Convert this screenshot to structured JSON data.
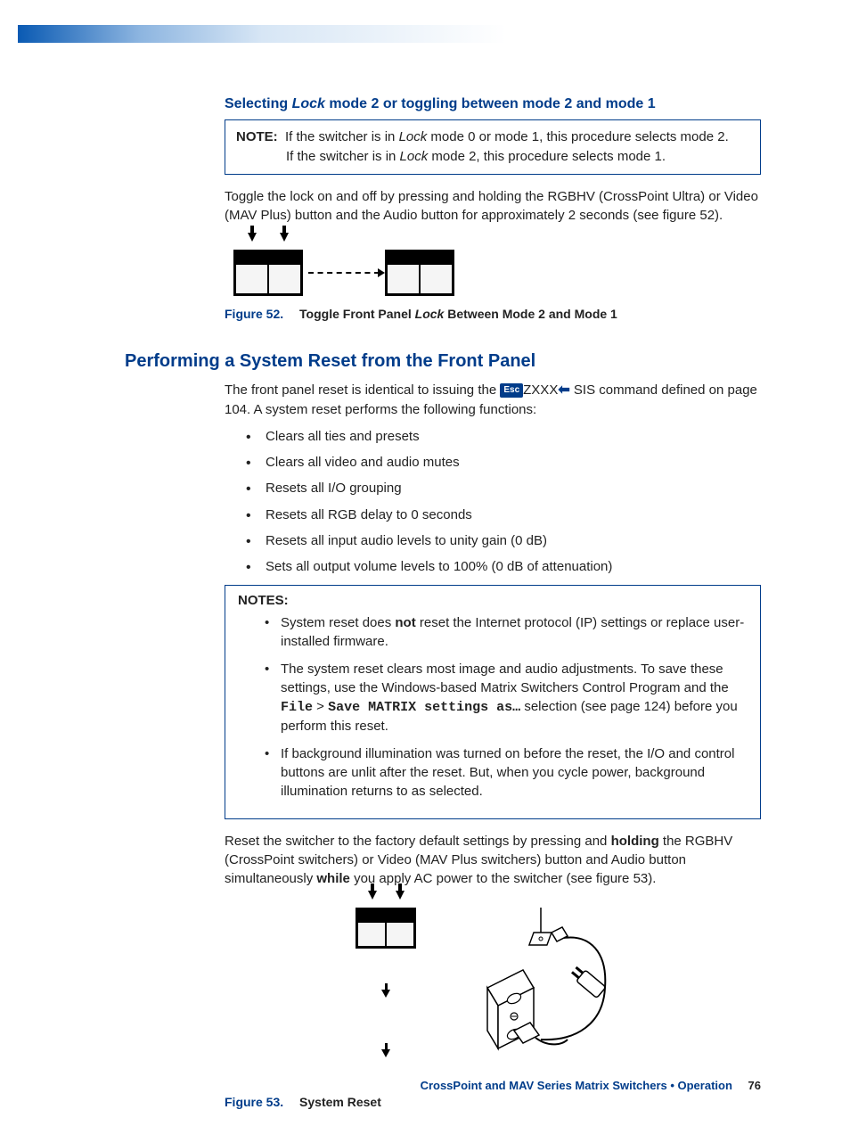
{
  "section1": {
    "heading_pre": "Selecting ",
    "heading_em": "Lock",
    "heading_post": " mode 2 or toggling between mode 2 and mode 1",
    "note_label": "NOTE:",
    "note_line1_pre": "If the switcher is in ",
    "note_line1_em": "Lock",
    "note_line1_post": " mode 0 or mode 1, this procedure selects mode 2.",
    "note_line2_pre": "If the switcher is in ",
    "note_line2_em": "Lock",
    "note_line2_post": " mode 2, this procedure selects mode 1.",
    "para": "Toggle the lock on and off by pressing and holding the RGBHV (CrossPoint Ultra) or Video (MAV Plus) button and the Audio button for approximately 2 seconds (see figure 52).",
    "fig_num": "Figure 52.",
    "fig_caption_pre": "Toggle Front Panel ",
    "fig_caption_em": "Lock",
    "fig_caption_post": " Between Mode 2 and Mode 1"
  },
  "section2": {
    "heading": "Performing a System Reset from the Front Panel",
    "intro_pre": "The front panel reset is identical to issuing the ",
    "esc": "Esc",
    "intro_code": "ZXXX",
    "intro_post": " SIS command defined on page 104. A system reset performs the following functions:",
    "bullets": [
      "Clears all ties and presets",
      "Clears all video and audio mutes",
      "Resets all I/O grouping",
      "Resets all RGB delay to 0 seconds",
      "Resets all input audio levels to unity gain (0 dB)",
      "Sets all output volume levels to 100% (0 dB of attenuation)"
    ],
    "notes_label": "NOTES:",
    "note_items": {
      "a_pre": "System reset does ",
      "a_bold": "not",
      "a_post": " reset the Internet protocol (IP) settings or replace user-installed firmware.",
      "b_pre": "The system reset clears most image and audio adjustments. To save these settings, use the Windows-based Matrix Switchers Control Program and the ",
      "b_mono1": "File",
      "b_gt": " > ",
      "b_mono2": "Save MATRIX settings as…",
      "b_post": " selection (see page 124) before you perform this reset.",
      "c": "If background illumination was turned on before the reset, the I/O and control buttons are unlit after the reset. But, when you cycle power, background illumination returns to as selected."
    },
    "para2_pre": "Reset the switcher to the factory default settings by pressing and ",
    "para2_bold1": "holding",
    "para2_mid": " the RGBHV (CrossPoint switchers) or Video (MAV Plus switchers) button and Audio button simultaneously ",
    "para2_bold2": "while",
    "para2_post": " you apply AC power to the switcher (see figure 53).",
    "fig53_num": "Figure 53.",
    "fig53_caption": "System Reset"
  },
  "footer": {
    "text": "CrossPoint and MAV Series Matrix Switchers • Operation",
    "page": "76"
  }
}
